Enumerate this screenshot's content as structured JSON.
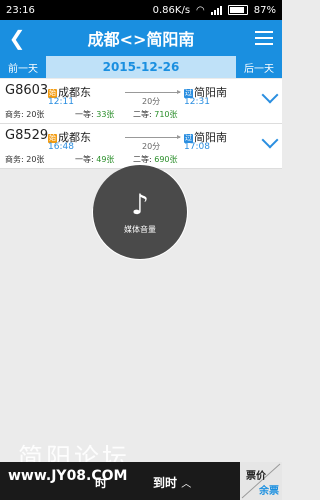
{
  "status": {
    "time": "23:16",
    "network_speed": "0.86K/s",
    "battery_percent": "87%"
  },
  "header": {
    "title": "成都<>简阳南"
  },
  "date_nav": {
    "prev_label": "前一天",
    "date": "2015-12-26",
    "next_label": "后一天"
  },
  "trains": [
    {
      "number": "G8603",
      "from_badge": "始",
      "from": "成都东",
      "dep_time": "12:11",
      "duration": "20分",
      "to_badge": "过",
      "to": "简阳南",
      "arr_time": "12:31",
      "seat1": "商务: 20张",
      "seat2_label": "一等: ",
      "seat2_value": "33张",
      "seat3_label": "二等: ",
      "seat3_value": "710张"
    },
    {
      "number": "G8529",
      "from_badge": "始",
      "from": "成都东",
      "dep_time": "16:48",
      "duration": "20分",
      "to_badge": "过",
      "to": "简阳南",
      "arr_time": "17:08",
      "seat1": "商务: 20张",
      "seat2_label": "一等: ",
      "seat2_value": "49张",
      "seat3_label": "二等: ",
      "seat3_value": "690张"
    }
  ],
  "media": {
    "icon": "music-note-icon",
    "label": "媒体音量"
  },
  "watermark": {
    "text": "简阳论坛"
  },
  "bottom": {
    "site": "www.JY08.COM",
    "sort1": "时",
    "sort2": "到时",
    "price_top": "票价",
    "price_bottom": "余票"
  },
  "colors": {
    "accent": "#1a8fe0",
    "available": "#2a8e2a"
  }
}
